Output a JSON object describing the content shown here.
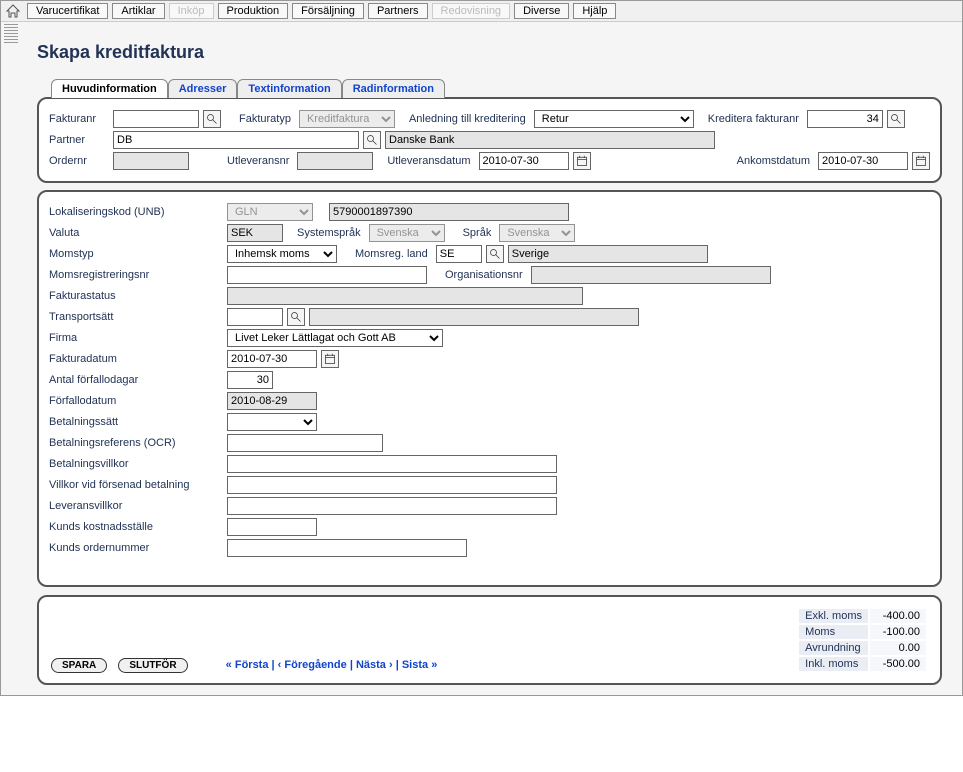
{
  "topmenu": {
    "items": [
      {
        "label": "Varucertifikat",
        "disabled": false
      },
      {
        "label": "Artiklar",
        "disabled": false
      },
      {
        "label": "Inköp",
        "disabled": true
      },
      {
        "label": "Produktion",
        "disabled": false
      },
      {
        "label": "Försäljning",
        "disabled": false
      },
      {
        "label": "Partners",
        "disabled": false
      },
      {
        "label": "Redovisning",
        "disabled": true
      },
      {
        "label": "Diverse",
        "disabled": false
      },
      {
        "label": "Hjälp",
        "disabled": false
      }
    ]
  },
  "page_title": "Skapa kreditfaktura",
  "tabs": [
    {
      "label": "Huvudinformation",
      "active": true
    },
    {
      "label": "Adresser",
      "active": false
    },
    {
      "label": "Textinformation",
      "active": false
    },
    {
      "label": "Radinformation",
      "active": false
    }
  ],
  "head": {
    "fakturanr_label": "Fakturanr",
    "fakturanr": "",
    "fakturatyp_label": "Fakturatyp",
    "fakturatyp": "Kreditfaktura",
    "anledning_label": "Anledning till kreditering",
    "anledning": "Retur",
    "kreditera_label": "Kreditera fakturanr",
    "kreditera": "34",
    "partner_label": "Partner",
    "partner_code": "DB",
    "partner_name": "Danske Bank",
    "ordernr_label": "Ordernr",
    "ordernr": "",
    "utleveransnr_label": "Utleveransnr",
    "utleveransnr": "",
    "utleveransdatum_label": "Utleveransdatum",
    "utleveransdatum": "2010-07-30",
    "ankomstdatum_label": "Ankomstdatum",
    "ankomstdatum": "2010-07-30"
  },
  "main": {
    "lokkod_label": "Lokaliseringskod (UNB)",
    "lokkod_type": "GLN",
    "lokkod_value": "5790001897390",
    "valuta_label": "Valuta",
    "valuta": "SEK",
    "systemsprak_label": "Systemspråk",
    "systemsprak": "Svenska",
    "sprak_label": "Språk",
    "sprak": "Svenska",
    "momstyp_label": "Momstyp",
    "momstyp": "Inhemsk moms",
    "momsreg_land_label": "Momsreg. land",
    "momsreg_land_code": "SE",
    "momsreg_land_name": "Sverige",
    "momsregnr_label": "Momsregistreringsnr",
    "momsregnr": "",
    "organisationsnr_label": "Organisationsnr",
    "organisationsnr": "",
    "fakturastatus_label": "Fakturastatus",
    "fakturastatus": "",
    "transportsatt_label": "Transportsätt",
    "transportsatt_code": "",
    "transportsatt_name": "",
    "firma_label": "Firma",
    "firma": "Livet Leker Lättlagat och Gott AB",
    "fakturadatum_label": "Fakturadatum",
    "fakturadatum": "2010-07-30",
    "antal_forfallodagar_label": "Antal förfallodagar",
    "antal_forfallodagar": "30",
    "forfallodatum_label": "Förfallodatum",
    "forfallodatum": "2010-08-29",
    "betalningssatt_label": "Betalningssätt",
    "betalningssatt": "",
    "betalningsreferens_label": "Betalningsreferens (OCR)",
    "betalningsreferens": "",
    "betalningsvillkor_label": "Betalningsvillkor",
    "betalningsvillkor": "",
    "villkor_forsenad_label": "Villkor vid försenad betalning",
    "villkor_forsenad": "",
    "leveransvillkor_label": "Leveransvillkor",
    "leveransvillkor": "",
    "kunds_kostnadsstalle_label": "Kunds kostnadsställe",
    "kunds_kostnadsstalle": "",
    "kunds_ordernummer_label": "Kunds ordernummer",
    "kunds_ordernummer": ""
  },
  "footer": {
    "spara": "SPARA",
    "slutfor": "SLUTFÖR",
    "nav_first": "« Första",
    "nav_prev": "‹ Föregående",
    "nav_next": "Nästa ›",
    "nav_last": "Sista »",
    "sep": " | ",
    "totals": {
      "exkl_label": "Exkl. moms",
      "exkl_value": "-400.00",
      "moms_label": "Moms",
      "moms_value": "-100.00",
      "avrundning_label": "Avrundning",
      "avrundning_value": "0.00",
      "inkl_label": "Inkl. moms",
      "inkl_value": "-500.00"
    }
  }
}
